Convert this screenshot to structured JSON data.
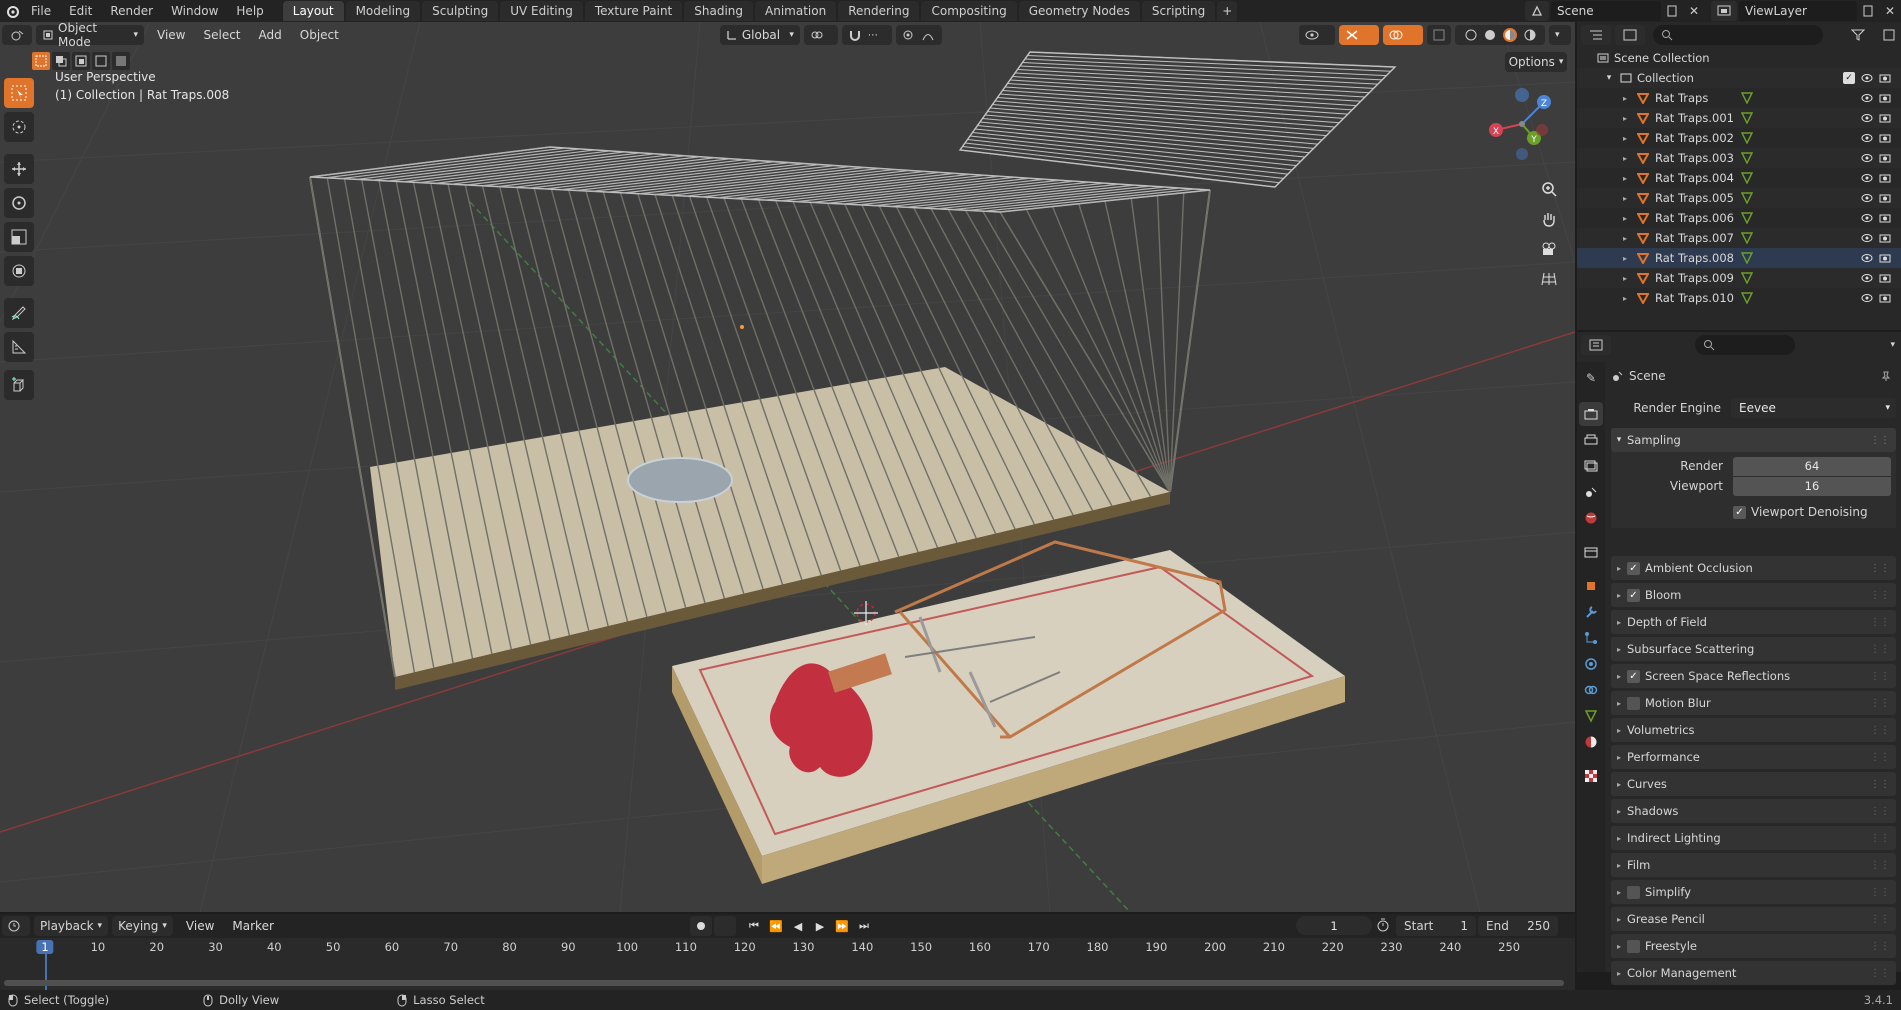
{
  "topbar": {
    "menus": [
      "File",
      "Edit",
      "Render",
      "Window",
      "Help"
    ],
    "workspaces": [
      "Layout",
      "Modeling",
      "Sculpting",
      "UV Editing",
      "Texture Paint",
      "Shading",
      "Animation",
      "Rendering",
      "Compositing",
      "Geometry Nodes",
      "Scripting"
    ],
    "active_workspace": "Layout",
    "add_tab": "+",
    "scene_name": "Scene",
    "view_layer": "ViewLayer"
  },
  "viewport": {
    "mode": "Object Mode",
    "menus": [
      "View",
      "Select",
      "Add",
      "Object"
    ],
    "orientation": "Global",
    "options_label": "Options",
    "overlay_title": "User Perspective",
    "overlay_subtitle": "(1) Collection | Rat Traps.008",
    "gizmo_axes": [
      "X",
      "Y",
      "Z"
    ]
  },
  "outliner": {
    "root": "Scene Collection",
    "collection": "Collection",
    "items": [
      "Rat Traps",
      "Rat Traps.001",
      "Rat Traps.002",
      "Rat Traps.003",
      "Rat Traps.004",
      "Rat Traps.005",
      "Rat Traps.006",
      "Rat Traps.007",
      "Rat Traps.008",
      "Rat Traps.009",
      "Rat Traps.010"
    ],
    "selected": "Rat Traps.008"
  },
  "properties": {
    "context": "Scene",
    "render_engine_label": "Render Engine",
    "render_engine": "Eevee",
    "sampling": {
      "title": "Sampling",
      "render_label": "Render",
      "render_value": "64",
      "viewport_label": "Viewport",
      "viewport_value": "16",
      "denoise_label": "Viewport Denoising",
      "denoise": true
    },
    "panels": [
      {
        "label": "Ambient Occlusion",
        "checkbox": true,
        "checked": true
      },
      {
        "label": "Bloom",
        "checkbox": true,
        "checked": true
      },
      {
        "label": "Depth of Field",
        "checkbox": false
      },
      {
        "label": "Subsurface Scattering",
        "checkbox": false
      },
      {
        "label": "Screen Space Reflections",
        "checkbox": true,
        "checked": true
      },
      {
        "label": "Motion Blur",
        "checkbox": true,
        "checked": false
      },
      {
        "label": "Volumetrics",
        "checkbox": false
      },
      {
        "label": "Performance",
        "checkbox": false
      },
      {
        "label": "Curves",
        "checkbox": false
      },
      {
        "label": "Shadows",
        "checkbox": false
      },
      {
        "label": "Indirect Lighting",
        "checkbox": false
      },
      {
        "label": "Film",
        "checkbox": false
      },
      {
        "label": "Simplify",
        "checkbox": true,
        "checked": false
      },
      {
        "label": "Grease Pencil",
        "checkbox": false
      },
      {
        "label": "Freestyle",
        "checkbox": true,
        "checked": false
      },
      {
        "label": "Color Management",
        "checkbox": false
      }
    ]
  },
  "timeline": {
    "menus": [
      "Playback",
      "Keying",
      "View",
      "Marker"
    ],
    "current_frame": "1",
    "start_label": "Start",
    "start": "1",
    "end_label": "End",
    "end": "250",
    "ticks": [
      "1",
      "10",
      "20",
      "30",
      "40",
      "50",
      "60",
      "70",
      "80",
      "90",
      "100",
      "110",
      "120",
      "130",
      "140",
      "150",
      "160",
      "170",
      "180",
      "190",
      "200",
      "210",
      "220",
      "230",
      "240",
      "250"
    ]
  },
  "statusbar": {
    "select": "Select (Toggle)",
    "dolly": "Dolly View",
    "lasso": "Lasso Select",
    "version": "3.4.1"
  },
  "colors": {
    "accent": "#4772b3",
    "selected_row": "#334d80",
    "active_tab": "#3d3d3d",
    "orange": "#e0742a"
  }
}
